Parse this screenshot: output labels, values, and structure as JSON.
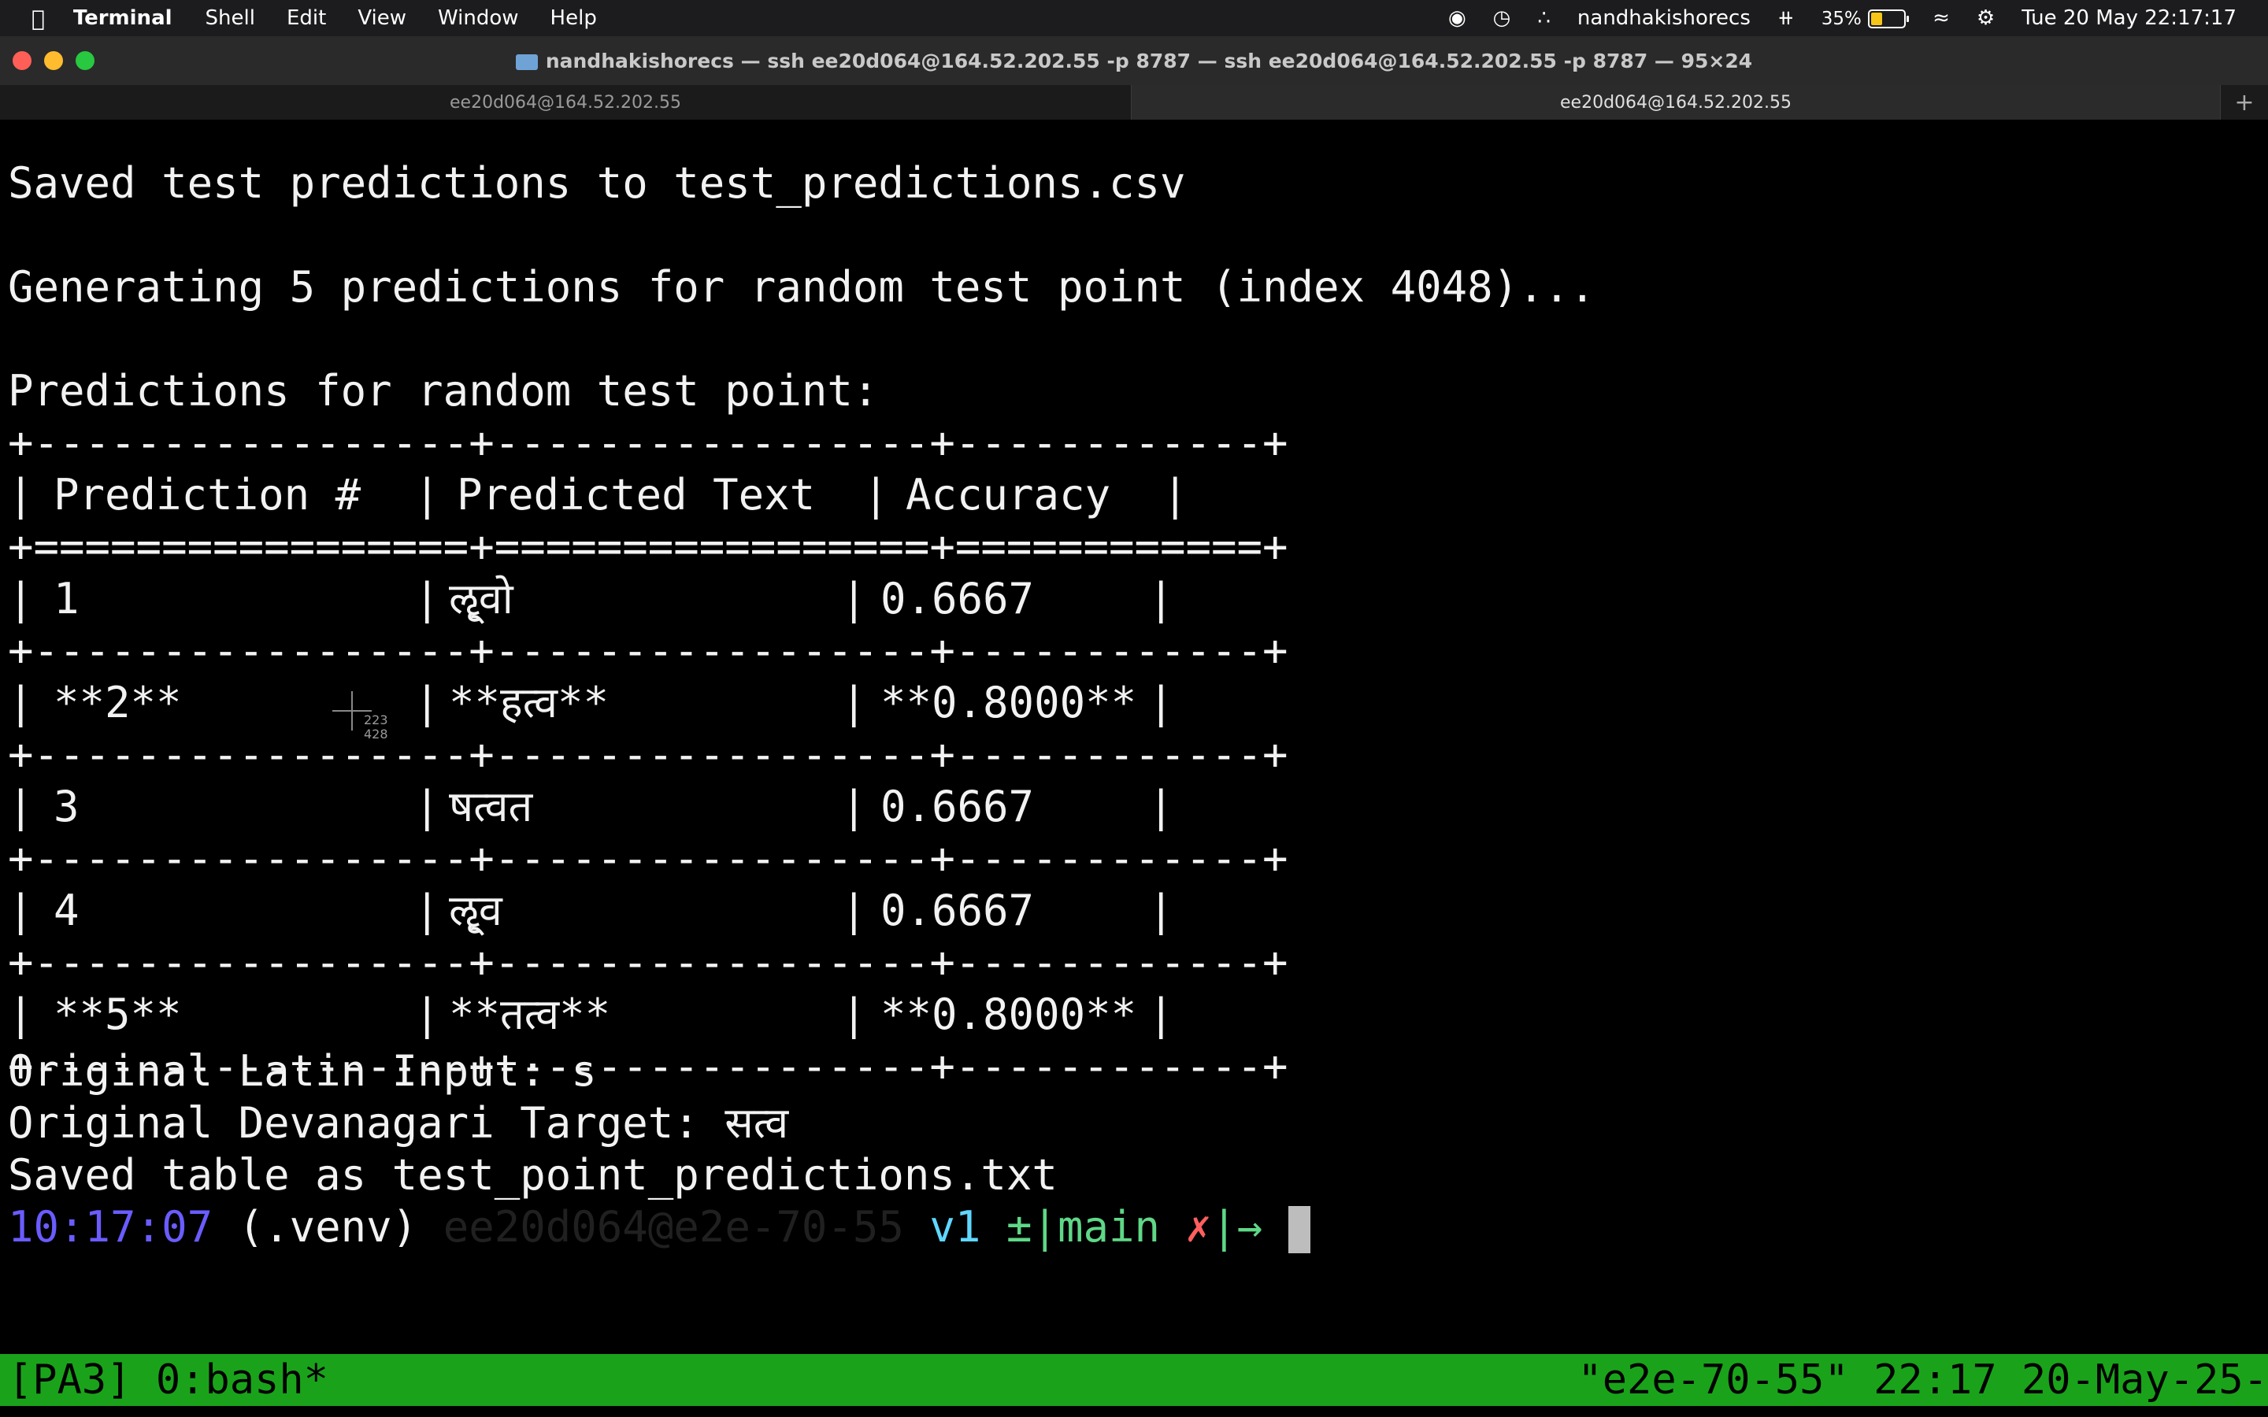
{
  "menubar": {
    "apple_icon": "apple-logo",
    "app_name": "Terminal",
    "items": [
      "Shell",
      "Edit",
      "View",
      "Window",
      "Help"
    ],
    "status": {
      "username": "nandhakishorecs",
      "battery": "35%",
      "battery_level": 0.35,
      "date_time": "Tue 20 May  22:17:17"
    }
  },
  "window": {
    "title": "nandhakishorecs — ssh ee20d064@164.52.202.55 -p 8787 — ssh ee20d064@164.52.202.55 -p 8787 — 95×24",
    "tabs": [
      {
        "label": "ee20d064@164.52.202.55",
        "active": false
      },
      {
        "label": "ee20d064@164.52.202.55",
        "active": true
      }
    ],
    "new_tab": "+"
  },
  "terminal": {
    "line_saved_preds": "Saved test predictions to test_predictions.csv",
    "line_generating": "Generating 5 predictions for random test point (index 4048)...",
    "line_predictions_header": "Predictions for random test point:",
    "table": {
      "border": "+-----------------+-----------------+------------+",
      "header_border": "+=================+=================+============+",
      "headers": [
        "Prediction #",
        "Predicted Text",
        "Accuracy"
      ],
      "rows": [
        {
          "num": "1",
          "text": "ॡ्वो",
          "acc": "0.6667"
        },
        {
          "num": "**2**",
          "text": "**हत्व**",
          "acc": "**0.8000**"
        },
        {
          "num": "3",
          "text": "षत्वत",
          "acc": "0.6667"
        },
        {
          "num": "4",
          "text": "ॡ्व",
          "acc": "0.6667"
        },
        {
          "num": "**5**",
          "text": "**तत्व**",
          "acc": "**0.8000**"
        }
      ]
    },
    "line_latin_input": "Original Latin Input: s",
    "line_devanagari_target": "Original Devanagari Target: सत्व",
    "line_saved_table": "Saved table as test_point_predictions.txt",
    "prompt": {
      "time": "10:17:07",
      "venv": "(.venv)",
      "host": "ee20d064@e2e-70-55",
      "version": "v1",
      "git": "±|main",
      "dirty": "✗",
      "arrow": "|→"
    },
    "crosshair_coords": [
      "223",
      "428"
    ]
  },
  "tmux": {
    "session": "[PA3] 0:bash*",
    "status_right": "\"e2e-70-55\" 22:17 20-May-25-"
  },
  "colors": {
    "tmux_bg": "#1aa31a",
    "prompt_time": "#6a5cff",
    "prompt_version": "#5fd7ff",
    "prompt_git": "#5fd787",
    "prompt_dirty": "#ff5f5f"
  }
}
